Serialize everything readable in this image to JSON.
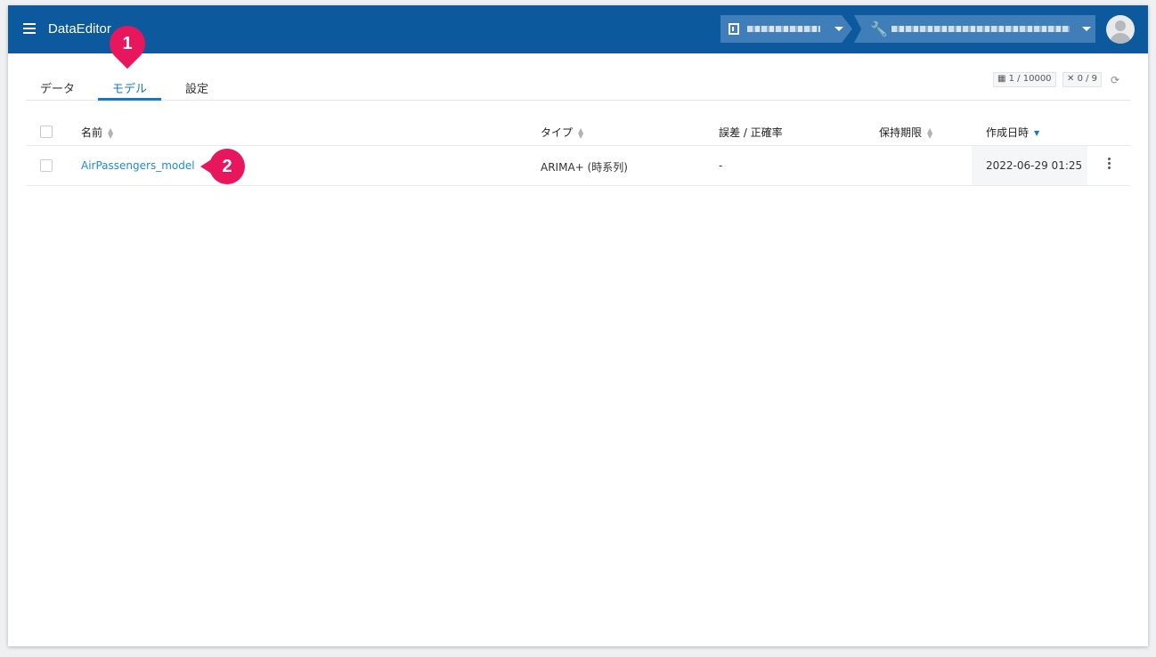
{
  "header": {
    "app_title": "DataEditor",
    "org_selector": "",
    "project_selector": ""
  },
  "tabs": [
    {
      "label": "データ"
    },
    {
      "label": "モデル"
    },
    {
      "label": "設定"
    }
  ],
  "active_tab": "モデル",
  "stats": {
    "rows": "1 / 10000",
    "jobs": "0 / 9"
  },
  "table": {
    "columns": [
      "名前",
      "タイプ",
      "誤差 / 正確率",
      "保持期限",
      "作成日時"
    ],
    "sorted_column": "作成日時",
    "rows": [
      {
        "name": "AirPassengers_model",
        "type": "ARIMA+ (時系列)",
        "error_accuracy": "-",
        "retention": "",
        "created": "2022-06-29 01:25"
      }
    ]
  },
  "annotations": {
    "marker_1": "1",
    "marker_2": "2"
  },
  "colors": {
    "header_bg": "#0c5a9d",
    "accent": "#1677c7",
    "link": "#1f8ad6",
    "annotation": "#e8175d"
  },
  "icons": [
    "hamburger-icon",
    "building-icon",
    "wrench-icon",
    "caret-down-icon",
    "avatar-icon",
    "table-icon",
    "jobs-icon",
    "refresh-icon",
    "sort-icon",
    "more-vert-icon"
  ]
}
